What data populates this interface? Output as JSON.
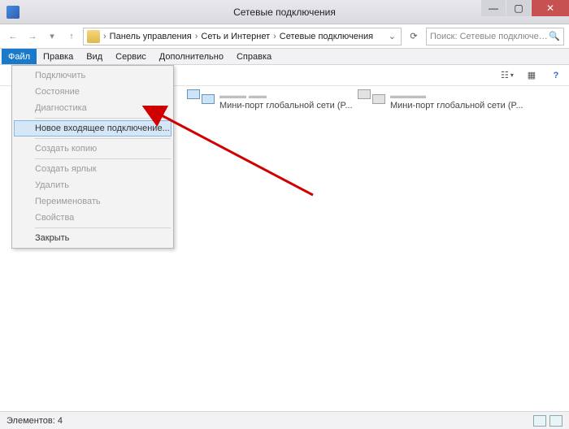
{
  "window": {
    "title": "Сетевые подключения"
  },
  "breadcrumb": {
    "segments": [
      "Панель управления",
      "Сеть и Интернет",
      "Сетевые подключения"
    ],
    "refresh_icon": "⟳"
  },
  "search": {
    "placeholder": "Поиск: Сетевые подключения",
    "icon": "🔍"
  },
  "nav": {
    "back": "←",
    "forward": "→",
    "dropdown": "▾",
    "up": "↑"
  },
  "menubar": {
    "items": [
      "Файл",
      "Правка",
      "Вид",
      "Сервис",
      "Дополнительно",
      "Справка"
    ],
    "active_index": 0
  },
  "toolbar": {
    "view_icon": "☷",
    "view_caret": "▾",
    "grid_icon": "▦",
    "help_icon": "?"
  },
  "dropdown": {
    "items": [
      {
        "label": "Подключить",
        "enabled": false
      },
      {
        "label": "Состояние",
        "enabled": false
      },
      {
        "label": "Диагностика",
        "enabled": false
      },
      {
        "sep": true
      },
      {
        "label": "Новое входящее подключение...",
        "enabled": true,
        "highlight": true
      },
      {
        "sep": true
      },
      {
        "label": "Создать копию",
        "enabled": false
      },
      {
        "sep": true
      },
      {
        "label": "Создать ярлык",
        "enabled": false
      },
      {
        "label": "Удалить",
        "enabled": false
      },
      {
        "label": "Переименовать",
        "enabled": false
      },
      {
        "label": "Свойства",
        "enabled": false
      },
      {
        "sep": true
      },
      {
        "label": "Закрыть",
        "enabled": true
      }
    ]
  },
  "connections": [
    {
      "subtitle": "Мини-порт глобальной сети (P...",
      "disabled": false
    },
    {
      "subtitle": "Мини-порт глобальной сети (P...",
      "disabled": true
    }
  ],
  "statusbar": {
    "text": "Элементов: 4"
  }
}
